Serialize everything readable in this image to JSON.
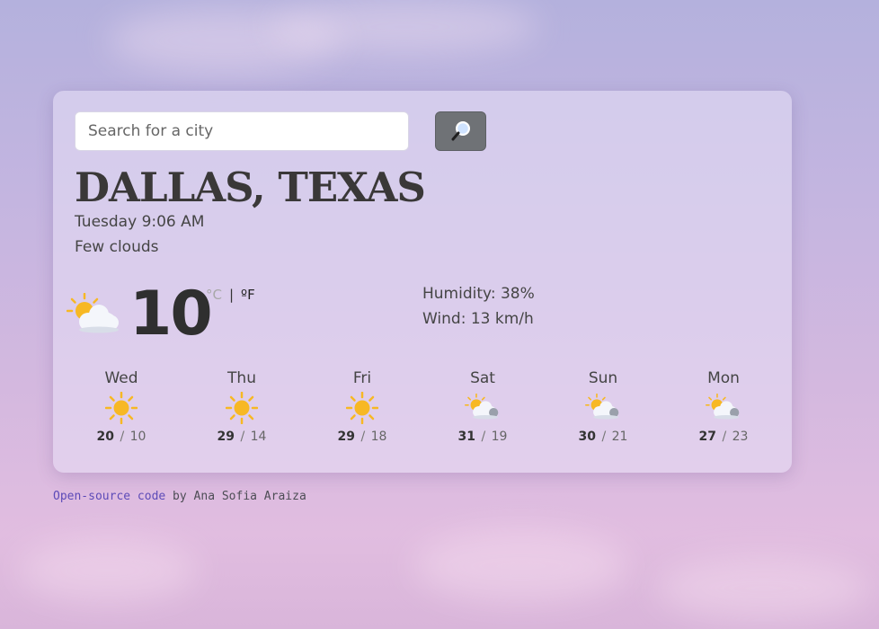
{
  "search": {
    "placeholder": "Search for a city",
    "button_icon": "magnifier-icon"
  },
  "location": {
    "city": "DALLAS, TEXAS",
    "datetime": "Tuesday 9:06 AM",
    "description": "Few clouds"
  },
  "current": {
    "icon": "sun-behind-cloud-icon",
    "temperature": "10",
    "unit_c": "°C",
    "separator": "|",
    "unit_f": "ºF",
    "humidity": "Humidity: 38%",
    "wind": "Wind: 13 km/h"
  },
  "forecast": [
    {
      "day": "Wed",
      "icon": "sun-icon",
      "max": "20",
      "sep": "/",
      "min": "10"
    },
    {
      "day": "Thu",
      "icon": "sun-icon",
      "max": "29",
      "sep": "/",
      "min": "14"
    },
    {
      "day": "Fri",
      "icon": "sun-icon",
      "max": "29",
      "sep": "/",
      "min": "18"
    },
    {
      "day": "Sat",
      "icon": "sun-behind-cloud-icon",
      "max": "31",
      "sep": "/",
      "min": "19"
    },
    {
      "day": "Sun",
      "icon": "sun-behind-cloud-icon",
      "max": "30",
      "sep": "/",
      "min": "21"
    },
    {
      "day": "Mon",
      "icon": "sun-behind-cloud-icon",
      "max": "27",
      "sep": "/",
      "min": "23"
    }
  ],
  "footer": {
    "link_text": "Open-source code",
    "by_text": " by Ana Sofia Araiza"
  },
  "colors": {
    "sun": "#f7b824",
    "cloud": "#f4f6fb",
    "link": "#5d4bb8",
    "button": "#6f7276"
  }
}
